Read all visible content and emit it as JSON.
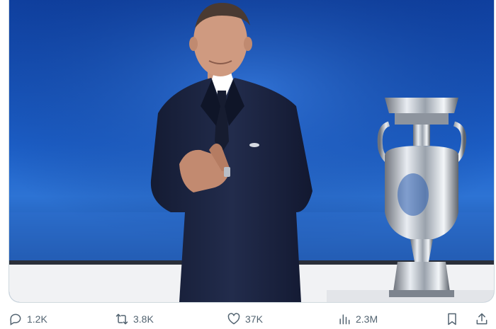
{
  "tweet": {
    "media": {
      "colors": {
        "backdrop": "#1247a8",
        "suit": "#1a2340",
        "stage": "#f2f3f5"
      }
    },
    "actions": {
      "reply": {
        "icon": "reply-icon",
        "count": "1.2K"
      },
      "retweet": {
        "icon": "retweet-icon",
        "count": "3.8K"
      },
      "like": {
        "icon": "heart-icon",
        "count": "37K"
      },
      "views": {
        "icon": "views-icon",
        "count": "2.3M"
      },
      "bookmark": {
        "icon": "bookmark-icon"
      },
      "share": {
        "icon": "share-icon"
      }
    }
  }
}
